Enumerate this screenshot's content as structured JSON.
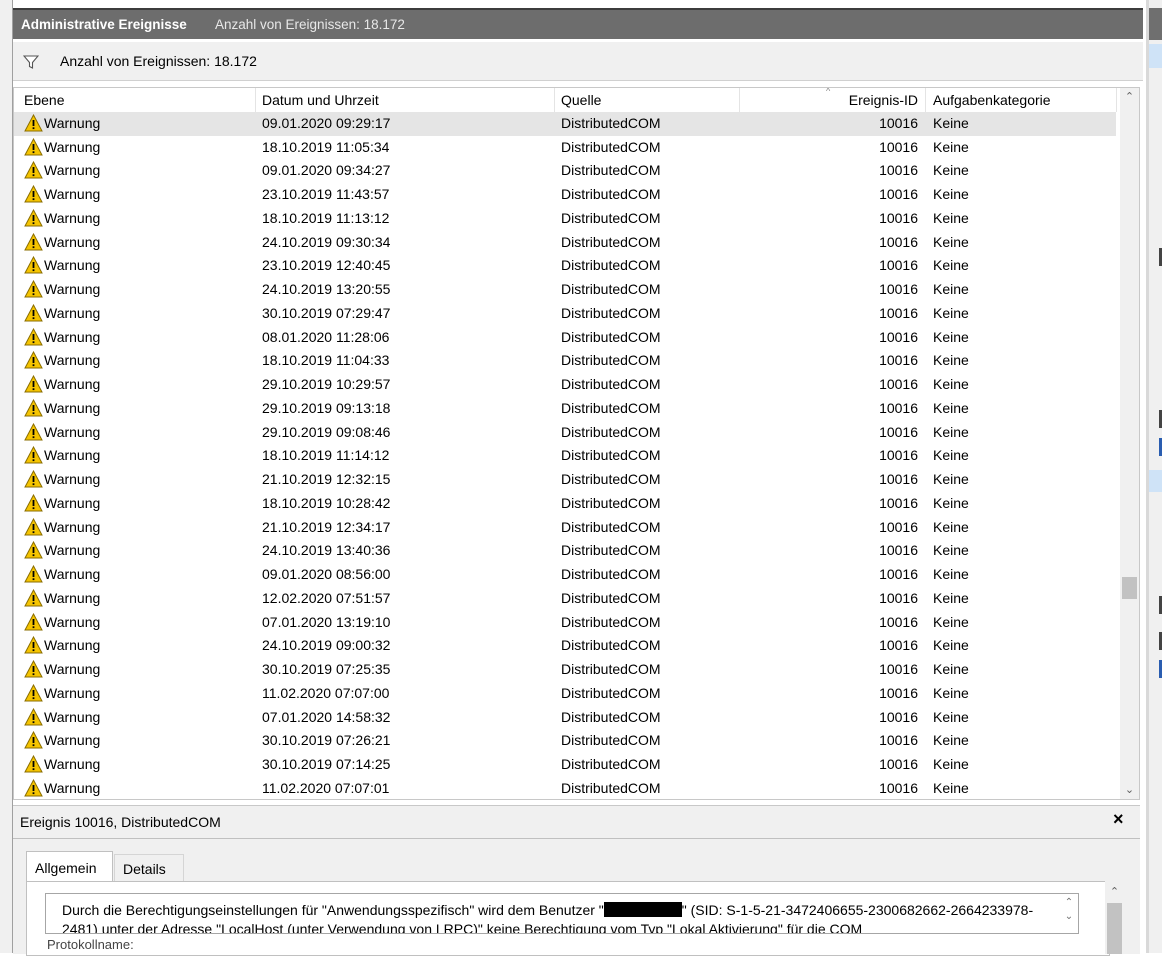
{
  "window": {
    "title": "Administrative Ereignisse",
    "subtitle": "Anzahl von Ereignissen: 18.172"
  },
  "filter": {
    "icon": "filter-funnel-icon",
    "text": "Anzahl von Ereignissen: 18.172"
  },
  "table": {
    "columns": [
      "Ebene",
      "Datum und Uhrzeit",
      "Quelle",
      "Ereignis-ID",
      "Aufgabenkategorie"
    ],
    "sort_indicator": "^",
    "selected_row_index": 0,
    "rows": [
      {
        "level": "Warnung",
        "date": "09.01.2020 09:29:17",
        "source": "DistributedCOM",
        "id": "10016",
        "category": "Keine"
      },
      {
        "level": "Warnung",
        "date": "18.10.2019 11:05:34",
        "source": "DistributedCOM",
        "id": "10016",
        "category": "Keine"
      },
      {
        "level": "Warnung",
        "date": "09.01.2020 09:34:27",
        "source": "DistributedCOM",
        "id": "10016",
        "category": "Keine"
      },
      {
        "level": "Warnung",
        "date": "23.10.2019 11:43:57",
        "source": "DistributedCOM",
        "id": "10016",
        "category": "Keine"
      },
      {
        "level": "Warnung",
        "date": "18.10.2019 11:13:12",
        "source": "DistributedCOM",
        "id": "10016",
        "category": "Keine"
      },
      {
        "level": "Warnung",
        "date": "24.10.2019 09:30:34",
        "source": "DistributedCOM",
        "id": "10016",
        "category": "Keine"
      },
      {
        "level": "Warnung",
        "date": "23.10.2019 12:40:45",
        "source": "DistributedCOM",
        "id": "10016",
        "category": "Keine"
      },
      {
        "level": "Warnung",
        "date": "24.10.2019 13:20:55",
        "source": "DistributedCOM",
        "id": "10016",
        "category": "Keine"
      },
      {
        "level": "Warnung",
        "date": "30.10.2019 07:29:47",
        "source": "DistributedCOM",
        "id": "10016",
        "category": "Keine"
      },
      {
        "level": "Warnung",
        "date": "08.01.2020 11:28:06",
        "source": "DistributedCOM",
        "id": "10016",
        "category": "Keine"
      },
      {
        "level": "Warnung",
        "date": "18.10.2019 11:04:33",
        "source": "DistributedCOM",
        "id": "10016",
        "category": "Keine"
      },
      {
        "level": "Warnung",
        "date": "29.10.2019 10:29:57",
        "source": "DistributedCOM",
        "id": "10016",
        "category": "Keine"
      },
      {
        "level": "Warnung",
        "date": "29.10.2019 09:13:18",
        "source": "DistributedCOM",
        "id": "10016",
        "category": "Keine"
      },
      {
        "level": "Warnung",
        "date": "29.10.2019 09:08:46",
        "source": "DistributedCOM",
        "id": "10016",
        "category": "Keine"
      },
      {
        "level": "Warnung",
        "date": "18.10.2019 11:14:12",
        "source": "DistributedCOM",
        "id": "10016",
        "category": "Keine"
      },
      {
        "level": "Warnung",
        "date": "21.10.2019 12:32:15",
        "source": "DistributedCOM",
        "id": "10016",
        "category": "Keine"
      },
      {
        "level": "Warnung",
        "date": "18.10.2019 10:28:42",
        "source": "DistributedCOM",
        "id": "10016",
        "category": "Keine"
      },
      {
        "level": "Warnung",
        "date": "21.10.2019 12:34:17",
        "source": "DistributedCOM",
        "id": "10016",
        "category": "Keine"
      },
      {
        "level": "Warnung",
        "date": "24.10.2019 13:40:36",
        "source": "DistributedCOM",
        "id": "10016",
        "category": "Keine"
      },
      {
        "level": "Warnung",
        "date": "09.01.2020 08:56:00",
        "source": "DistributedCOM",
        "id": "10016",
        "category": "Keine"
      },
      {
        "level": "Warnung",
        "date": "12.02.2020 07:51:57",
        "source": "DistributedCOM",
        "id": "10016",
        "category": "Keine"
      },
      {
        "level": "Warnung",
        "date": "07.01.2020 13:19:10",
        "source": "DistributedCOM",
        "id": "10016",
        "category": "Keine"
      },
      {
        "level": "Warnung",
        "date": "24.10.2019 09:00:32",
        "source": "DistributedCOM",
        "id": "10016",
        "category": "Keine"
      },
      {
        "level": "Warnung",
        "date": "30.10.2019 07:25:35",
        "source": "DistributedCOM",
        "id": "10016",
        "category": "Keine"
      },
      {
        "level": "Warnung",
        "date": "11.02.2020 07:07:00",
        "source": "DistributedCOM",
        "id": "10016",
        "category": "Keine"
      },
      {
        "level": "Warnung",
        "date": "07.01.2020 14:58:32",
        "source": "DistributedCOM",
        "id": "10016",
        "category": "Keine"
      },
      {
        "level": "Warnung",
        "date": "30.10.2019 07:26:21",
        "source": "DistributedCOM",
        "id": "10016",
        "category": "Keine"
      },
      {
        "level": "Warnung",
        "date": "30.10.2019 07:14:25",
        "source": "DistributedCOM",
        "id": "10016",
        "category": "Keine"
      },
      {
        "level": "Warnung",
        "date": "11.02.2020 07:07:01",
        "source": "DistributedCOM",
        "id": "10016",
        "category": "Keine"
      }
    ]
  },
  "detail": {
    "title": "Ereignis 10016, DistributedCOM",
    "close_label": "×",
    "tabs": [
      "Allgemein",
      "Details"
    ],
    "message_part1": "Durch die Berechtigungseinstellungen für \"Anwendungsspezifisch\" wird dem Benutzer \"",
    "message_part2": "\" (SID: S-1-5-21-3472406655-2300682662-2664233978-2481) unter der Adresse \"LocalHost (unter Verwendung von LRPC)\" keine Berechtigung vom Typ \"Lokal Aktivierung\" für die COM",
    "lower_label": "Protokollname:"
  },
  "colors": {
    "title_bar": "#6d6d6d",
    "selected_row": "#e5e5e5",
    "warning_yellow": "#f5c400"
  }
}
